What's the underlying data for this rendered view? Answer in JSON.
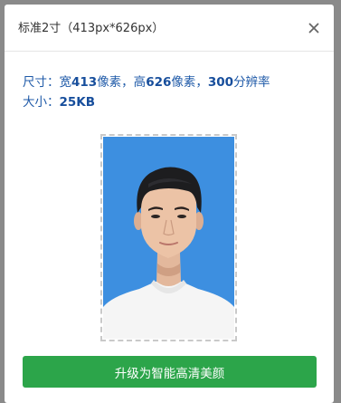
{
  "dialog": {
    "title": "标准2寸（413px*626px）",
    "close_icon": "close-icon"
  },
  "info": {
    "size_label": "尺寸：",
    "width_prefix": "宽",
    "width_value": "413",
    "width_unit": "像素，高",
    "height_value": "626",
    "height_unit": "像素，",
    "dpi_value": "300",
    "dpi_unit": "分辨率",
    "file_label": "大小：",
    "file_value": "25KB"
  },
  "photo": {
    "background_color": "#3d8fe0"
  },
  "actions": {
    "upgrade_label": "升级为智能高清美颜",
    "upgrade_color": "#2ca54a"
  }
}
